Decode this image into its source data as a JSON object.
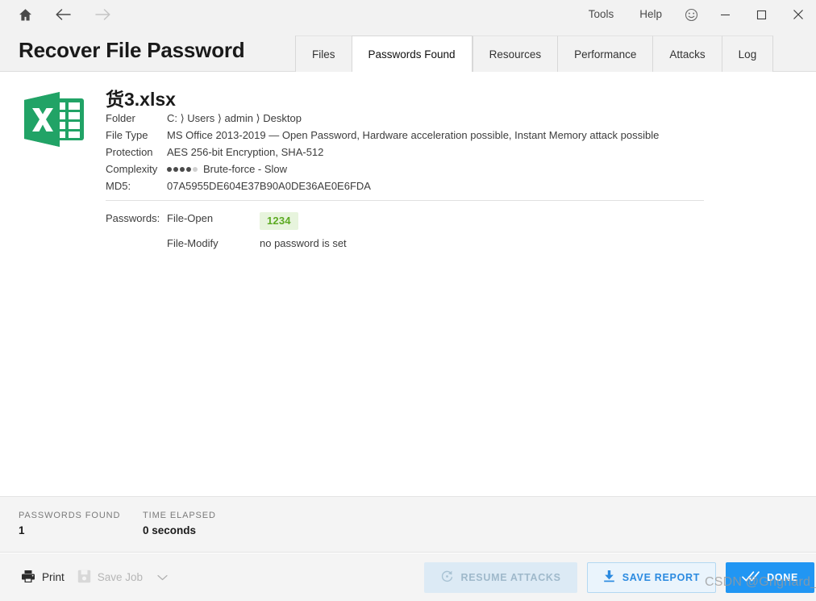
{
  "titlebar": {
    "nav": [
      {
        "name": "home-icon",
        "label": "Home"
      },
      {
        "name": "back-icon",
        "label": "Back"
      },
      {
        "name": "forward-icon",
        "label": "Forward"
      }
    ],
    "menus": [
      {
        "label": "Tools"
      },
      {
        "label": "Help"
      }
    ],
    "smiley_label": "Feedback",
    "window_controls": [
      {
        "name": "minimize",
        "glyph": "–"
      },
      {
        "name": "maximize",
        "glyph": "□"
      },
      {
        "name": "close",
        "glyph": "✕"
      }
    ]
  },
  "header": {
    "title": "Recover File Password",
    "tabs": [
      {
        "label": "Files",
        "active": false
      },
      {
        "label": "Passwords Found",
        "active": true
      },
      {
        "label": "Resources",
        "active": false
      },
      {
        "label": "Performance",
        "active": false
      },
      {
        "label": "Attacks",
        "active": false
      },
      {
        "label": "Log",
        "active": false
      }
    ]
  },
  "file": {
    "icon": "excel-file-icon",
    "name": "货3.xlsx",
    "details": [
      {
        "label": "Folder",
        "value": "C: ⟩ Users ⟩ admin ⟩ Desktop"
      },
      {
        "label": "File Type",
        "value": "MS Office 2013-2019 — Open Password, Hardware acceleration possible, Instant Memory attack possible"
      },
      {
        "label": "Protection",
        "value": "AES 256-bit Encryption, SHA-512"
      },
      {
        "label": "Complexity",
        "value": "Brute-force - Slow",
        "dots_filled": 4,
        "dots_total": 5
      },
      {
        "label": "MD5:",
        "value": "07A5955DE604E37B90A0DE36AE0E6FDA"
      }
    ]
  },
  "passwords": {
    "heading": "Passwords:",
    "rows": [
      {
        "kind": "File-Open",
        "value": "1234",
        "is_badge": true
      },
      {
        "kind": "File-Modify",
        "value": "no password is set",
        "is_badge": false
      }
    ]
  },
  "statusbar": {
    "stats": [
      {
        "label": "PASSWORDS FOUND",
        "value": "1"
      },
      {
        "label": "TIME ELAPSED",
        "value": "0 seconds"
      }
    ]
  },
  "actions": {
    "print_label": "Print",
    "save_job_label": "Save Job",
    "resume_label": "RESUME ATTACKS",
    "save_report_label": "SAVE REPORT",
    "done_label": "DONE"
  },
  "watermark": "CSDN @Grignard_",
  "colors": {
    "accent_blue": "#2196f3",
    "password_green": "#5caa22",
    "password_green_bg": "#e7f4dd",
    "chrome_gray": "#f2f2f2",
    "excel_green": "#21a366"
  }
}
